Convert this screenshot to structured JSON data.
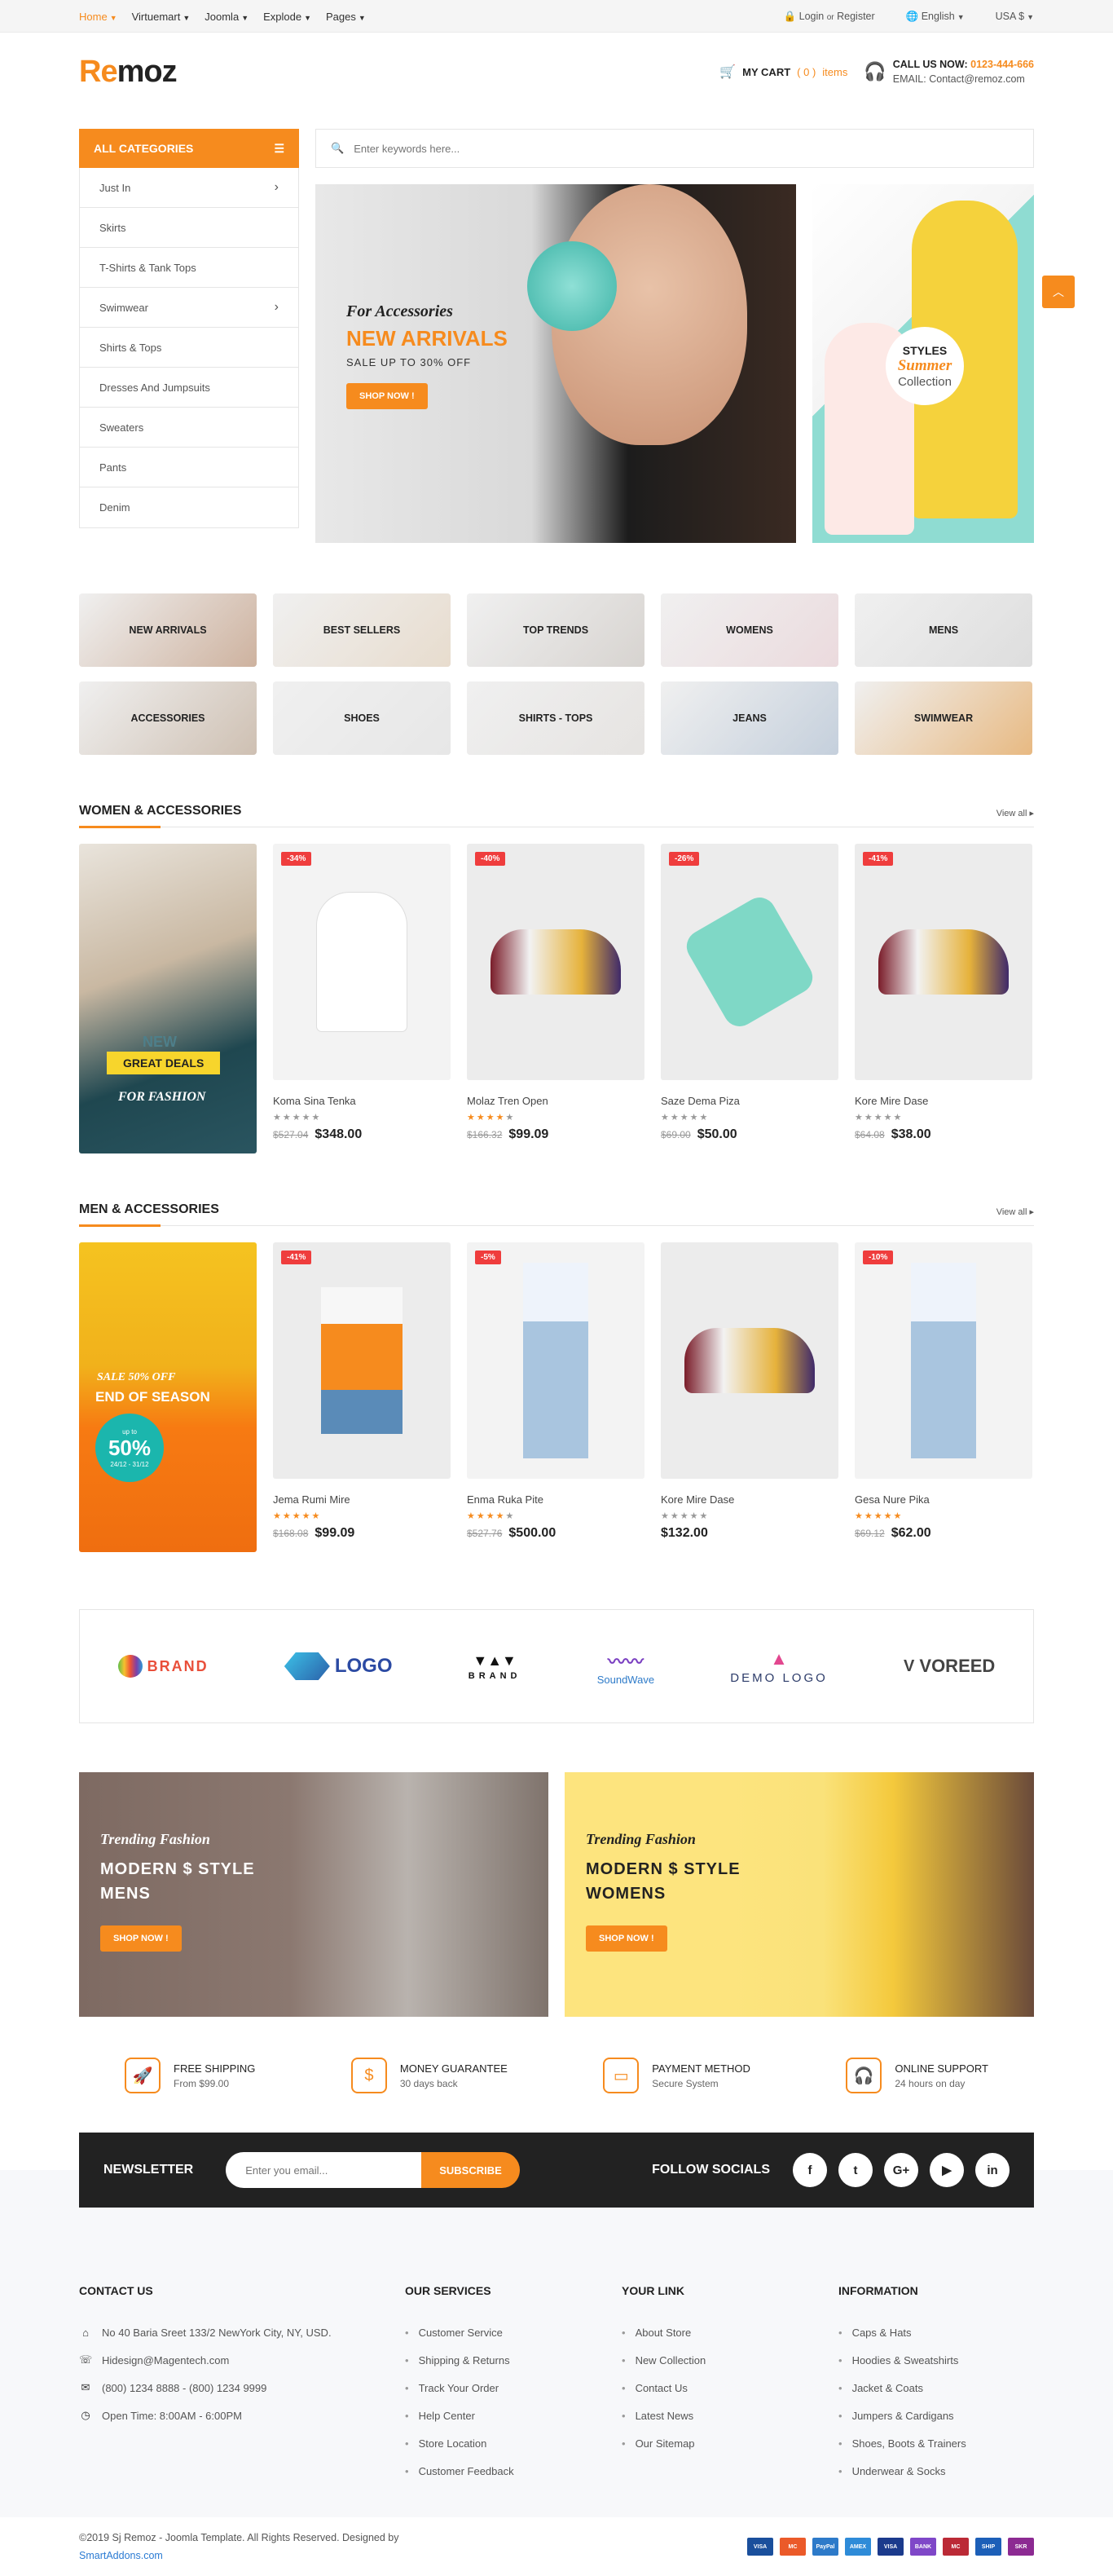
{
  "topbar": {
    "nav": [
      "Home",
      "Virtuemart",
      "Joomla",
      "Explode",
      "Pages"
    ],
    "login": "Login",
    "or": "or",
    "register": "Register",
    "language": "English",
    "currency": "USA $"
  },
  "header": {
    "logo_a": "Re",
    "logo_b": "moz",
    "cart_label": "MY CART",
    "cart_count": "( 0 )",
    "cart_items": "items",
    "call_label": "CALL US NOW:",
    "phone": "0123-444-666",
    "email_label": "EMAIL:",
    "email": "Contact@remoz.com"
  },
  "categories": {
    "title": "ALL CATEGORIES",
    "items": [
      {
        "label": "Just In",
        "arrow": true
      },
      {
        "label": "Skirts",
        "arrow": false
      },
      {
        "label": "T-Shirts & Tank Tops",
        "arrow": false
      },
      {
        "label": "Swimwear",
        "arrow": true
      },
      {
        "label": "Shirts & Tops",
        "arrow": false
      },
      {
        "label": "Dresses And Jumpsuits",
        "arrow": false
      },
      {
        "label": "Sweaters",
        "arrow": false
      },
      {
        "label": "Pants",
        "arrow": false
      },
      {
        "label": "Denim",
        "arrow": false
      }
    ]
  },
  "search": {
    "placeholder": "Enter keywords here..."
  },
  "hero": {
    "script": "For Accessories",
    "title": "NEW ARRIVALS",
    "sub": "SALE UP TO 30% OFF",
    "button": "SHOP NOW !"
  },
  "side_banner": {
    "styles": "STYLES",
    "summer": "Summer",
    "collection": "Collection"
  },
  "tiles": [
    "NEW ARRIVALS",
    "BEST SELLERS",
    "TOP TRENDS",
    "WOMENS",
    "MENS",
    "ACCESSORIES",
    "SHOES",
    "SHIRTS - TOPS",
    "JEANS",
    "SWIMWEAR"
  ],
  "women": {
    "title": "WOMEN & ACCESSORIES",
    "view_all": "View all",
    "promo_new": "NEW",
    "promo_deal": "GREAT DEALS",
    "promo_fashion": "FOR FASHION",
    "products": [
      {
        "tag": "-34%",
        "name": "Koma Sina Tenka",
        "rating": 0,
        "old": "$527.04",
        "price": "$348.00",
        "shape": "shirt"
      },
      {
        "tag": "-40%",
        "name": "Molaz Tren Open",
        "rating": 4,
        "old": "$166.32",
        "price": "$99.09",
        "shape": "shoe"
      },
      {
        "tag": "-26%",
        "name": "Saze Dema Piza",
        "rating": 0,
        "old": "$69.00",
        "price": "$50.00",
        "shape": "scarf"
      },
      {
        "tag": "-41%",
        "name": "Kore Mire Dase",
        "rating": 0,
        "old": "$64.08",
        "price": "$38.00",
        "shape": "shoe"
      }
    ]
  },
  "men": {
    "title": "MEN & ACCESSORIES",
    "view_all": "View all",
    "promo_sale": "SALE 50% OFF",
    "promo_end": "END OF SEASON",
    "promo_upto": "up to",
    "promo_pct": "50%",
    "promo_dates": "24/12 - 31/12",
    "products": [
      {
        "tag": "-41%",
        "name": "Jema Rumi Mire",
        "rating": 5,
        "old": "$168.08",
        "price": "$99.09",
        "shape": "top"
      },
      {
        "tag": "-5%",
        "name": "Enma Ruka Pite",
        "rating": 4,
        "old": "$527.76",
        "price": "$500.00",
        "shape": "jeans"
      },
      {
        "tag": "",
        "name": "Kore Mire Dase",
        "rating": 0,
        "old": "",
        "price": "$132.00",
        "shape": "shoe"
      },
      {
        "tag": "-10%",
        "name": "Gesa Nure Pika",
        "rating": 5,
        "old": "$69.12",
        "price": "$62.00",
        "shape": "jeans"
      }
    ]
  },
  "brands": [
    "BRAND",
    "LOGO",
    "BRAND",
    "SoundWave",
    "DEMO LOGO",
    "VOREED"
  ],
  "trending": [
    {
      "script": "Trending Fashion",
      "line1": "MODERN $ STYLE",
      "line2": "MENS",
      "button": "SHOP NOW !"
    },
    {
      "script": "Trending Fashion",
      "line1": "MODERN $ STYLE",
      "line2": "WOMENS",
      "button": "SHOP NOW !"
    }
  ],
  "services": [
    {
      "icon": "rocket-icon",
      "title": "FREE SHIPPING",
      "sub": "From $99.00"
    },
    {
      "icon": "money-bag-icon",
      "title": "MONEY GUARANTEE",
      "sub": "30 days back"
    },
    {
      "icon": "wallet-icon",
      "title": "PAYMENT METHOD",
      "sub": "Secure System"
    },
    {
      "icon": "headset-icon",
      "title": "ONLINE SUPPORT",
      "sub": "24 hours on day"
    }
  ],
  "newsletter": {
    "label": "NEWSLETTER",
    "placeholder": "Enter you email...",
    "button": "SUBSCRIBE",
    "follow": "FOLLOW SOCIALS",
    "socials": [
      "f",
      "t",
      "G+",
      "▶",
      "in"
    ]
  },
  "footer": {
    "contact_title": "CONTACT US",
    "contact": [
      {
        "icon": "home-icon",
        "text": "No 40 Baria Sreet 133/2 NewYork City, NY, USD."
      },
      {
        "icon": "phone-icon",
        "text": "Hidesign@Magentech.com"
      },
      {
        "icon": "mail-icon",
        "text": "(800) 1234 8888 - (800) 1234 9999"
      },
      {
        "icon": "clock-icon",
        "text": "Open Time: 8:00AM - 6:00PM"
      }
    ],
    "services_title": "OUR SERVICES",
    "services": [
      "Customer Service",
      "Shipping & Returns",
      "Track Your Order",
      "Help Center",
      "Store Location",
      "Customer Feedback"
    ],
    "link_title": "YOUR LINK",
    "links": [
      "About Store",
      "New Collection",
      "Contact Us",
      "Latest News",
      "Our Sitemap"
    ],
    "info_title": "INFORMATION",
    "info": [
      "Caps & Hats",
      "Hoodies & Sweatshirts",
      "Jacket & Coats",
      "Jumpers & Cardigans",
      "Shoes, Boots & Trainers",
      "Underwear & Socks"
    ]
  },
  "bottom": {
    "copy": "©2019 Sj Remoz - Joomla Template. All Rights Reserved. Designed by",
    "designer": "SmartAddons.com",
    "cards": [
      {
        "label": "VISA",
        "color": "#1a4f9c"
      },
      {
        "label": "MC",
        "color": "#eb5a29"
      },
      {
        "label": "PayPal",
        "color": "#2d7ac9"
      },
      {
        "label": "AMEX",
        "color": "#2e8bd8"
      },
      {
        "label": "VISA",
        "color": "#1b3a8c"
      },
      {
        "label": "BANK",
        "color": "#7f47c8"
      },
      {
        "label": "MC",
        "color": "#bb2a36"
      },
      {
        "label": "SHIP",
        "color": "#1c5fb8"
      },
      {
        "label": "SKR",
        "color": "#8c2a92"
      }
    ]
  },
  "colors": {
    "accent": "#f68b1e",
    "sale": "#ef3d3d",
    "dark": "#222222"
  }
}
